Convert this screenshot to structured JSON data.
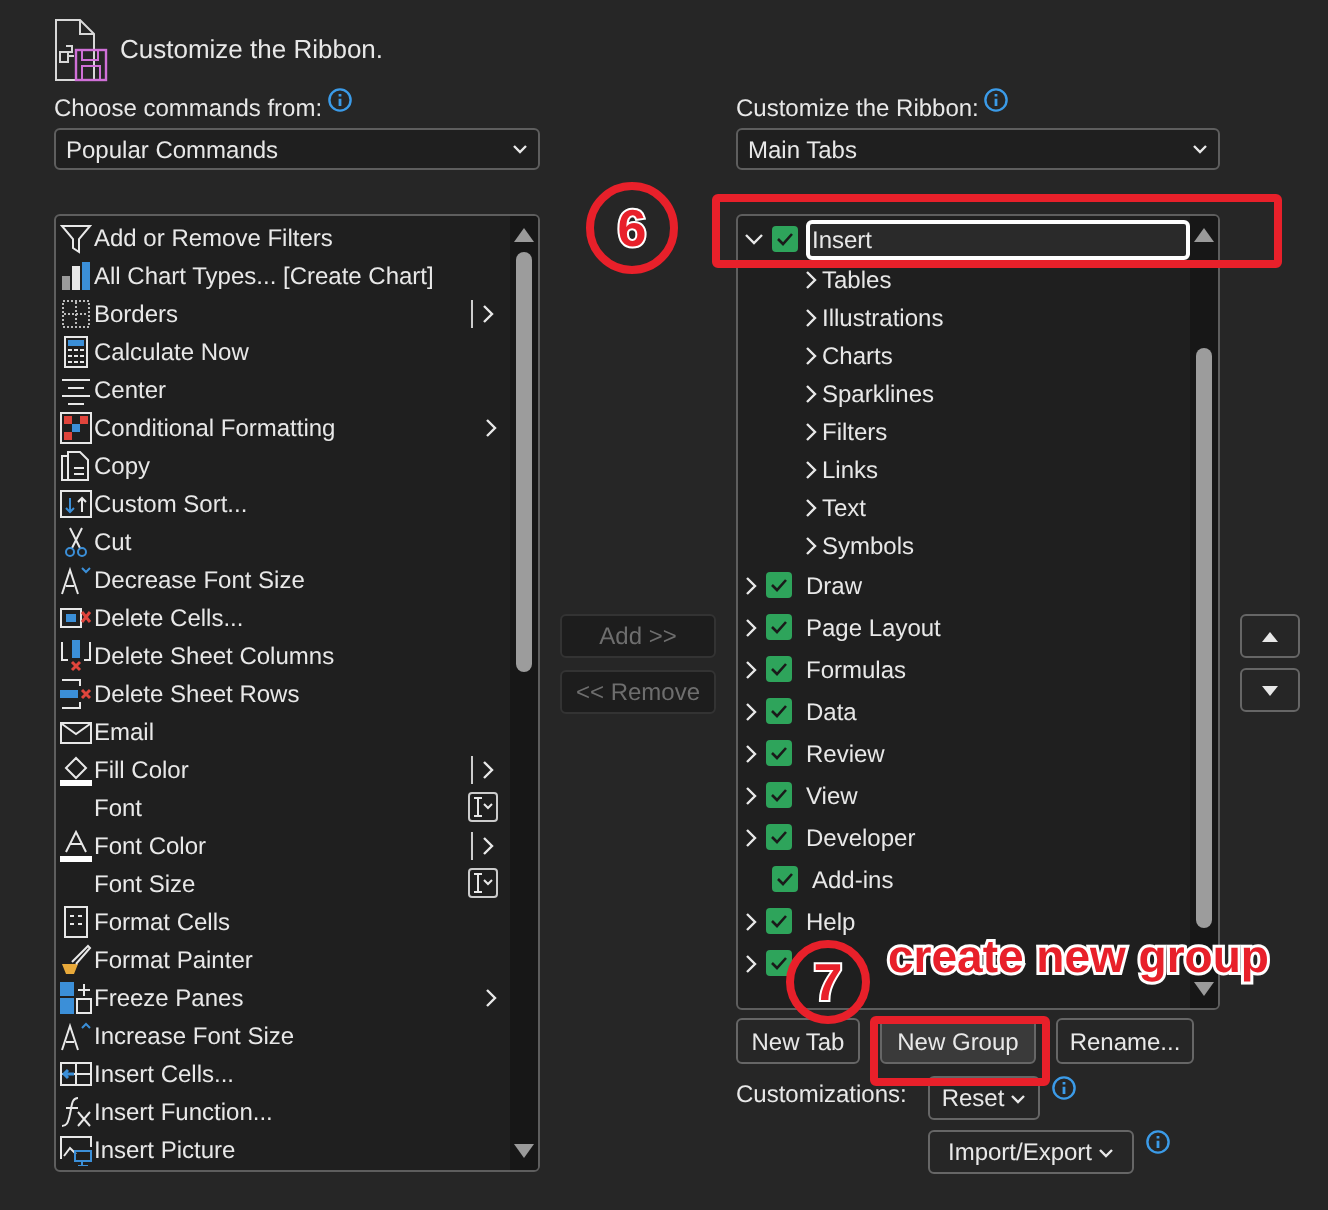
{
  "dialog_title": "Customize the Ribbon.",
  "commands_panel": {
    "label": "Choose commands from:",
    "dropdown": "Popular Commands",
    "items": [
      {
        "label": "Add or Remove Filters"
      },
      {
        "label": "All Chart Types... [Create Chart]"
      },
      {
        "label": "Borders",
        "kind": "split"
      },
      {
        "label": "Calculate Now"
      },
      {
        "label": "Center"
      },
      {
        "label": "Conditional Formatting",
        "kind": "arrow"
      },
      {
        "label": "Copy"
      },
      {
        "label": "Custom Sort..."
      },
      {
        "label": "Cut"
      },
      {
        "label": "Decrease Font Size"
      },
      {
        "label": "Delete Cells..."
      },
      {
        "label": "Delete Sheet Columns"
      },
      {
        "label": "Delete Sheet Rows"
      },
      {
        "label": "Email"
      },
      {
        "label": "Fill Color",
        "kind": "split"
      },
      {
        "label": "Font",
        "kind": "combo"
      },
      {
        "label": "Font Color",
        "kind": "split"
      },
      {
        "label": "Font Size",
        "kind": "combo"
      },
      {
        "label": "Format Cells"
      },
      {
        "label": "Format Painter"
      },
      {
        "label": "Freeze Panes",
        "kind": "arrow"
      },
      {
        "label": "Increase Font Size"
      },
      {
        "label": "Insert Cells..."
      },
      {
        "label": "Insert Function..."
      },
      {
        "label": "Insert Picture"
      }
    ]
  },
  "transfer_buttons": [
    {
      "label": "Add >>",
      "disabled": true
    },
    {
      "label": "<< Remove",
      "disabled": true
    }
  ],
  "ribbon_panel": {
    "label": "Customize the Ribbon:",
    "dropdown": "Main Tabs",
    "tabs": [
      {
        "label": "Insert",
        "checked": true,
        "expanded": true,
        "selected": true,
        "children": [
          {
            "label": "Tables"
          },
          {
            "label": "Illustrations"
          },
          {
            "label": "Charts"
          },
          {
            "label": "Sparklines"
          },
          {
            "label": "Filters"
          },
          {
            "label": "Links"
          },
          {
            "label": "Text"
          },
          {
            "label": "Symbols"
          }
        ]
      },
      {
        "label": "Draw",
        "checked": true,
        "expanded": false,
        "selected": false
      },
      {
        "label": "Page Layout",
        "checked": true,
        "expanded": false,
        "selected": false
      },
      {
        "label": "Formulas",
        "checked": true,
        "expanded": false,
        "selected": false
      },
      {
        "label": "Data",
        "checked": true,
        "expanded": false,
        "selected": false
      },
      {
        "label": "Review",
        "checked": true,
        "expanded": false,
        "selected": false
      },
      {
        "label": "View",
        "checked": true,
        "expanded": false,
        "selected": false
      },
      {
        "label": "Developer",
        "checked": true,
        "expanded": false,
        "selected": false
      },
      {
        "label": "Add-ins",
        "checked": true,
        "selected": false
      },
      {
        "label": "Help",
        "checked": true,
        "expanded": false,
        "selected": false
      },
      {
        "checked": true,
        "expanded": false,
        "selected": false
      }
    ],
    "buttons": [
      "New Tab",
      "New Group",
      "Rename..."
    ],
    "customizations_label": "Customizations:",
    "reset_button": "Reset",
    "import_export_button": "Import/Export"
  },
  "annotations": [
    {
      "kind": "step",
      "text": "6"
    },
    {
      "kind": "highlight"
    },
    {
      "kind": "step",
      "text": "7"
    },
    {
      "kind": "caption",
      "text": "create new group"
    },
    {
      "kind": "highlight"
    }
  ]
}
